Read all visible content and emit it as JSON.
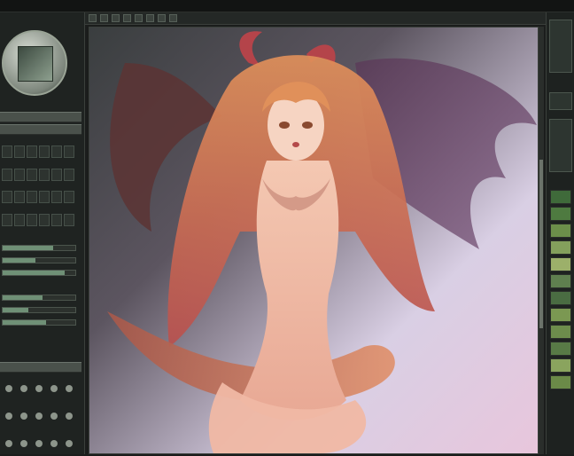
{
  "menubar": {
    "items": [
      "",
      "",
      "",
      "",
      "",
      "",
      "",
      ""
    ]
  },
  "colors": {
    "ui_background": "#1b1d1c",
    "panel": "#1f2321",
    "accent_green": "#6f9076",
    "swatches": [
      "#3f6a3a",
      "#4e7a40",
      "#6c8f4a",
      "#84a05c",
      "#9cb06a",
      "#5f7f4f",
      "#4a6c42",
      "#7b9852",
      "#6d8c4c",
      "#587a46",
      "#8aa45e",
      "#6b8a48"
    ]
  },
  "icons": {
    "navigator": "navigator-icon",
    "brush": "brush-icon",
    "color_dot": "color-dot-icon"
  },
  "sliders": {
    "values": [
      0.7,
      0.45,
      0.85,
      0.55,
      0.35,
      0.6
    ]
  }
}
